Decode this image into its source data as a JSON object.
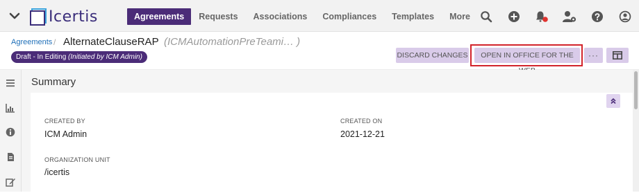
{
  "nav": {
    "items": [
      {
        "label": "Agreements",
        "active": true
      },
      {
        "label": "Requests",
        "active": false
      },
      {
        "label": "Associations",
        "active": false
      },
      {
        "label": "Compliances",
        "active": false
      },
      {
        "label": "Templates",
        "active": false
      },
      {
        "label": "More",
        "active": false
      }
    ]
  },
  "brand": {
    "name": "Icertis",
    "color": "#3a2d7a",
    "accent": "#4b2c78"
  },
  "top_icons": [
    "search-icon",
    "add-icon",
    "notification-bell-icon",
    "user-settings-icon",
    "help-icon",
    "user-profile-icon"
  ],
  "header": {
    "breadcrumb": "Agreements",
    "title": "AlternateClauseRAP",
    "subtitle": "(ICMAutomationPreTeami… )",
    "status_prefix": "Draft - In Editing",
    "status_detail": "(Initiated by ICM Admin)"
  },
  "actions": {
    "discard": "DISCARD CHANGES",
    "open_office": "OPEN IN OFFICE FOR THE WEB",
    "more": "···"
  },
  "sidebar_icons": [
    "menu-icon",
    "chart-icon",
    "info-icon",
    "document-icon",
    "edit-icon"
  ],
  "summary": {
    "title": "Summary",
    "fields": {
      "created_by_label": "CREATED BY",
      "created_by": "ICM Admin",
      "created_on_label": "CREATED ON",
      "created_on": "2021-12-21",
      "org_unit_label": "ORGANIZATION UNIT",
      "org_unit": "/icertis"
    }
  },
  "colors": {
    "highlight": "#d2232a",
    "button_bg": "#d9cbe9",
    "link": "#1f6fb8"
  }
}
